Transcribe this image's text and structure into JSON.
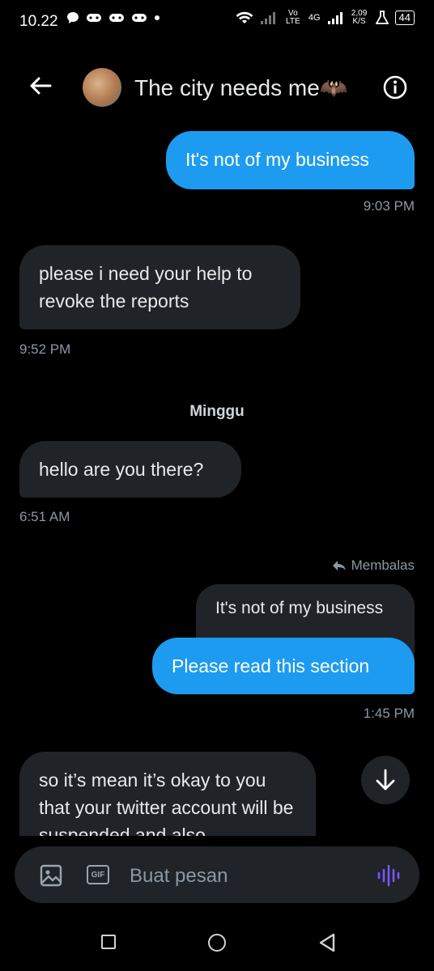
{
  "status_bar": {
    "time": "10.22",
    "net_label": "Vo LTE",
    "net_type": "4G",
    "speed": "2,09 K/S",
    "battery": "44"
  },
  "header": {
    "title": "The city needs me🦇",
    "back_icon": "arrow-left-icon",
    "info_icon": "info-icon"
  },
  "messages": [
    {
      "text": "It's not of my business",
      "time": "9:03 PM",
      "side": "sent"
    },
    {
      "text": "please i need your help to revoke the reports",
      "time": "9:52 PM",
      "side": "received"
    },
    {
      "text": "hello are you there?",
      "time": "6:51 AM",
      "side": "received"
    },
    {
      "reply_label": "Membalas",
      "quoted": "It's not of my business",
      "text": "Please read this section",
      "time": "1:45 PM",
      "side": "sent"
    },
    {
      "text": "so it’s mean it’s okay to you that your twitter account will be suspended and also",
      "side": "received"
    }
  ],
  "day_separator": "Minggu",
  "composer": {
    "placeholder": "Buat pesan",
    "gif_label": "GIF"
  },
  "colors": {
    "accent": "#1d9bf0",
    "received_bubble": "#202327",
    "voice": "#7856ff"
  }
}
